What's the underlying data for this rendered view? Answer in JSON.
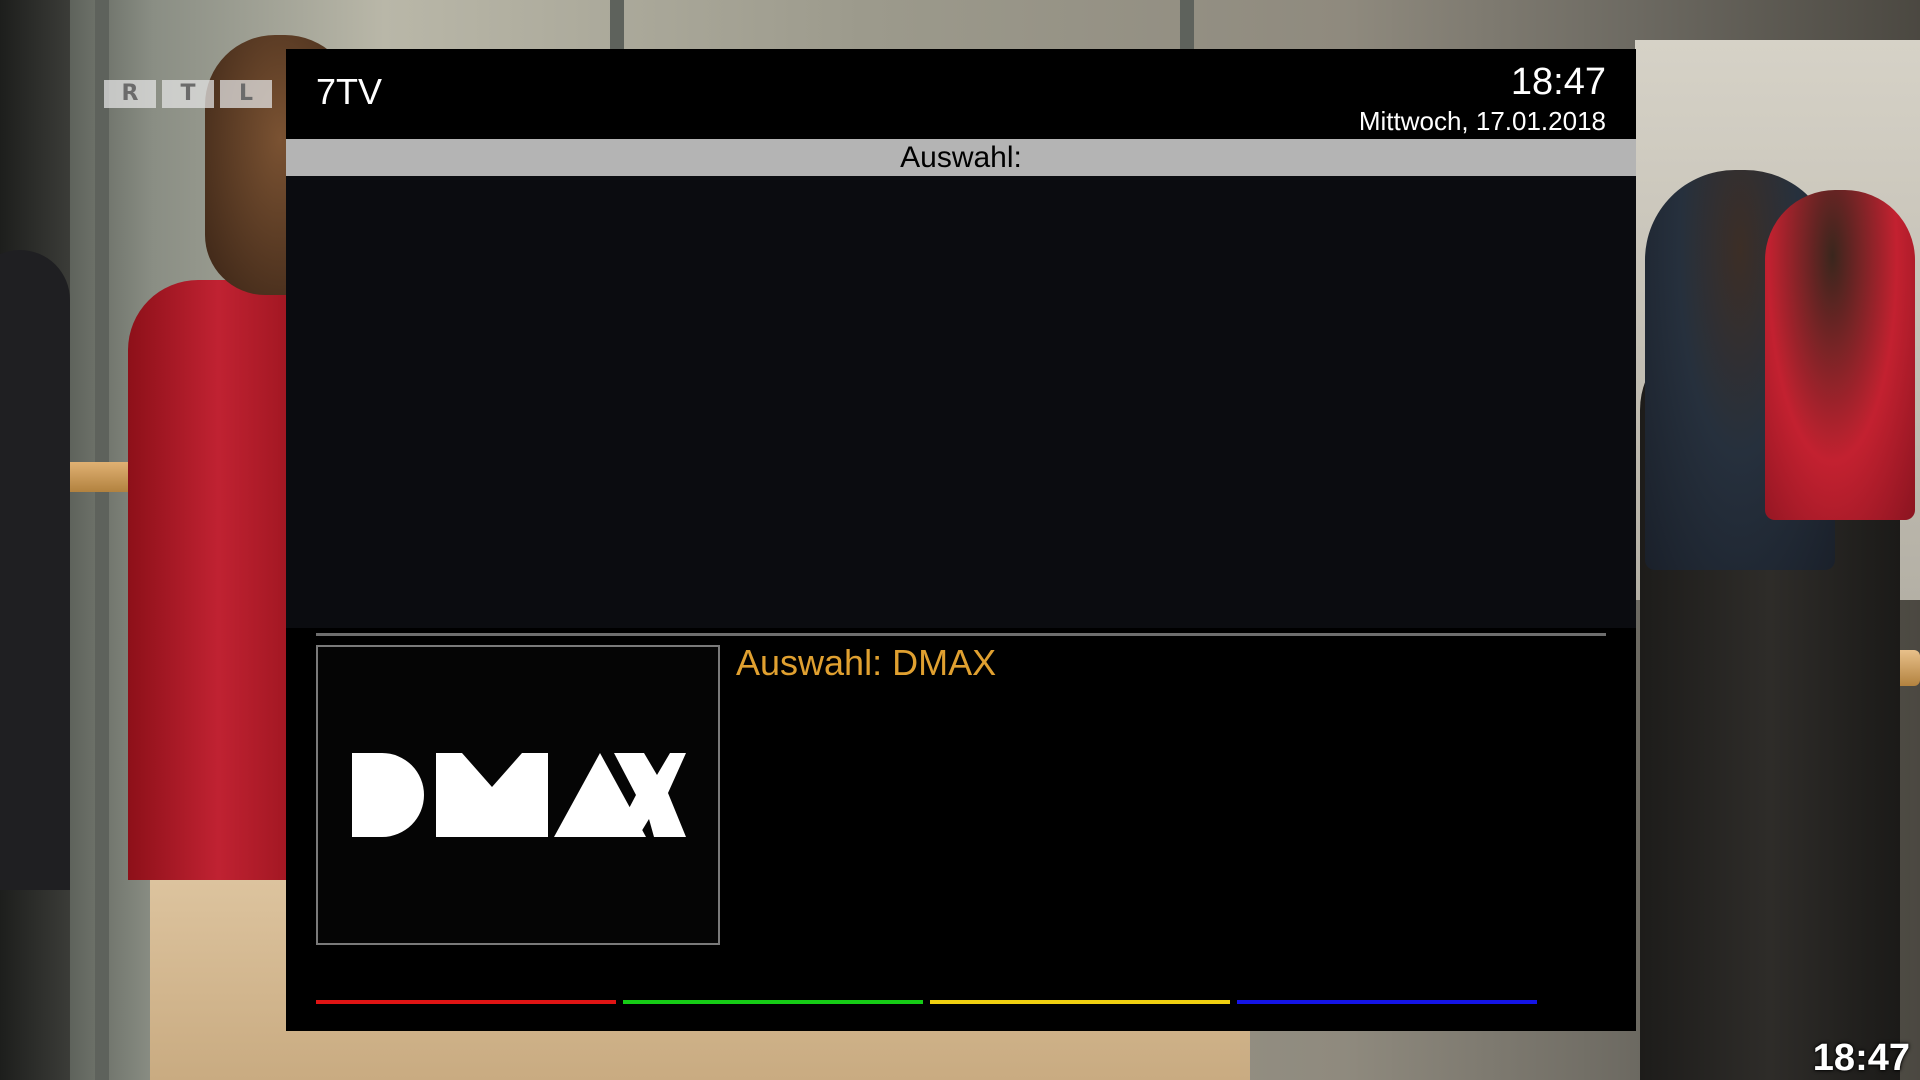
{
  "broadcaster_logo": [
    "R",
    "T",
    "L"
  ],
  "corner_clock": "18:47",
  "header": {
    "channel": "7TV",
    "time": "18:47",
    "date": "Mittwoch, 17.01.2018"
  },
  "title_bar": "Auswahl:",
  "list_items": [],
  "selection": {
    "label": "Auswahl: DMAX",
    "logo_text": "DMAX"
  },
  "color_keys": {
    "red": "#e01414",
    "green": "#16cc16",
    "yellow": "#f0d010",
    "blue": "#1414e6"
  },
  "colors": {
    "selection_text": "#e0a030",
    "title_bar_bg": "#b4b4b4"
  }
}
